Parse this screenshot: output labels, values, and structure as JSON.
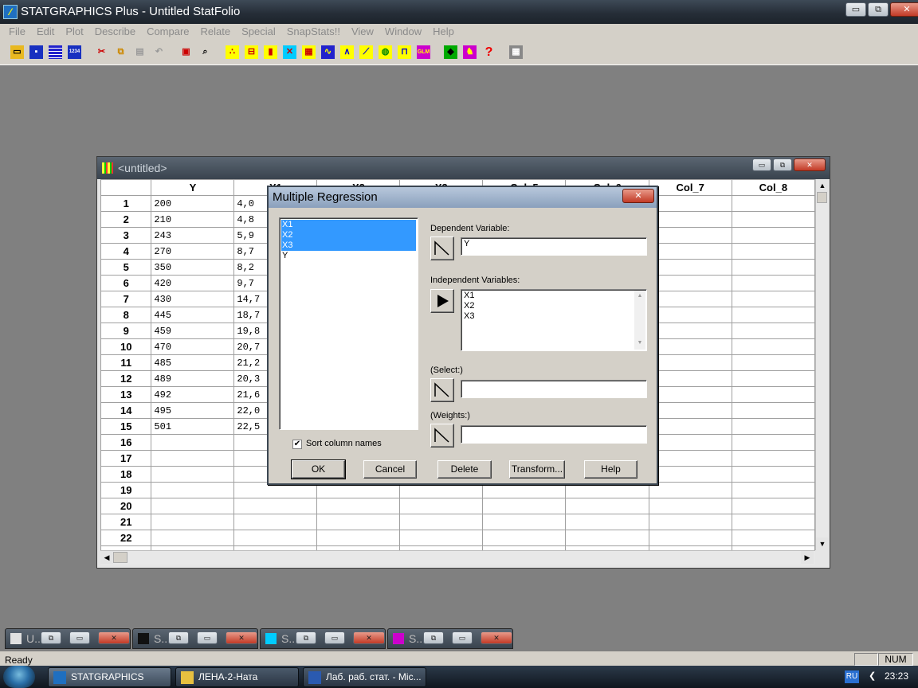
{
  "app": {
    "title": "STATGRAPHICS Plus - Untitled StatFolio",
    "menu": [
      "File",
      "Edit",
      "Plot",
      "Describe",
      "Compare",
      "Relate",
      "Special",
      "SnapStats!!",
      "View",
      "Window",
      "Help"
    ],
    "window_buttons": {
      "minimize": "▭",
      "restore": "⧉",
      "close": "✕"
    }
  },
  "toolbar": {
    "icons": [
      "open-icon",
      "save-icon",
      "datasheet-icon",
      "save-data-icon",
      "cut-icon",
      "copy-icon",
      "paste-icon",
      "undo-icon",
      "print-icon",
      "print-preview-icon",
      "scatterplot-icon",
      "boxplot-icon",
      "barchart-icon",
      "xyplot-icon",
      "matrix-plot-icon",
      "timeseries-icon",
      "distribution-icon",
      "regression-icon",
      "globe-icon",
      "control-chart-icon",
      "glm-icon",
      "snapstats-icon",
      "wizard-icon",
      "help-icon",
      "calculator-icon"
    ]
  },
  "datasheet": {
    "title": "<untitled>",
    "columns": [
      "Y",
      "X1",
      "X2",
      "X3",
      "Col_5",
      "Col_6",
      "Col_7",
      "Col_8"
    ],
    "rows": [
      [
        "1",
        "200",
        "4,0"
      ],
      [
        "2",
        "210",
        "4,8"
      ],
      [
        "3",
        "243",
        "5,9"
      ],
      [
        "4",
        "270",
        "8,7"
      ],
      [
        "5",
        "350",
        "8,2"
      ],
      [
        "6",
        "420",
        "9,7"
      ],
      [
        "7",
        "430",
        "14,7"
      ],
      [
        "8",
        "445",
        "18,7"
      ],
      [
        "9",
        "459",
        "19,8"
      ],
      [
        "10",
        "470",
        "20,7"
      ],
      [
        "11",
        "485",
        "21,2"
      ],
      [
        "12",
        "489",
        "20,3"
      ],
      [
        "13",
        "492",
        "21,6"
      ],
      [
        "14",
        "495",
        "22,0"
      ],
      [
        "15",
        "501",
        "22,5"
      ],
      [
        "16",
        "",
        ""
      ],
      [
        "17",
        "",
        ""
      ],
      [
        "18",
        "",
        ""
      ],
      [
        "19",
        "",
        ""
      ],
      [
        "20",
        "",
        ""
      ],
      [
        "21",
        "",
        ""
      ],
      [
        "22",
        "",
        ""
      ],
      [
        "23",
        "",
        ""
      ]
    ]
  },
  "dialog": {
    "title": "Multiple Regression",
    "close": "✕",
    "variable_list": [
      {
        "name": "X1",
        "selected": true
      },
      {
        "name": "X2",
        "selected": true
      },
      {
        "name": "X3",
        "selected": true
      },
      {
        "name": "Y",
        "selected": false
      }
    ],
    "sort_label": "Sort column names",
    "sort_checked": "✔",
    "dependent_label": "Dependent Variable:",
    "dependent_value": "Y",
    "independent_label": "Independent Variables:",
    "independent_values": [
      "X1",
      "X2",
      "X3"
    ],
    "select_label": "(Select:)",
    "select_value": "",
    "weights_label": "(Weights:)",
    "weights_value": "",
    "buttons": {
      "ok": "OK",
      "cancel": "Cancel",
      "delete": "Delete",
      "transform": "Transform...",
      "help": "Help"
    }
  },
  "minimized_windows": [
    "U...",
    "S...",
    "S...",
    "S..."
  ],
  "status": {
    "text": "Ready",
    "num": "NUM"
  },
  "taskbar": {
    "tasks": [
      "STATGRAPHICS Plus...",
      "ЛЕНА-2-Ната",
      "Лаб. раб. стат. - Mic..."
    ],
    "lang": "RU",
    "clock": "23:23"
  }
}
